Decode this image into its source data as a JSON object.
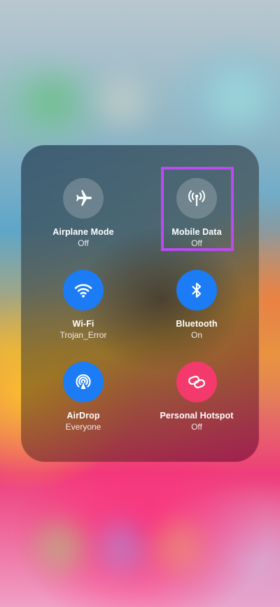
{
  "control_center": {
    "tiles": [
      {
        "id": "airplane",
        "label": "Airplane Mode",
        "status": "Off",
        "icon": "airplane-icon",
        "state": "off"
      },
      {
        "id": "mobile",
        "label": "Mobile Data",
        "status": "Off",
        "icon": "antenna-icon",
        "state": "off"
      },
      {
        "id": "wifi",
        "label": "Wi-Fi",
        "status": "Trojan_Error",
        "icon": "wifi-icon",
        "state": "on"
      },
      {
        "id": "bluetooth",
        "label": "Bluetooth",
        "status": "On",
        "icon": "bluetooth-icon",
        "state": "on"
      },
      {
        "id": "airdrop",
        "label": "AirDrop",
        "status": "Everyone",
        "icon": "airdrop-icon",
        "state": "on"
      },
      {
        "id": "hotspot",
        "label": "Personal Hotspot",
        "status": "Off",
        "icon": "personal-hotspot-icon",
        "state": "off"
      }
    ]
  },
  "colors": {
    "active_blue": "#1b7cf5",
    "hotspot_pink": "#f43a6c",
    "highlight_purple": "#b84cf0"
  }
}
